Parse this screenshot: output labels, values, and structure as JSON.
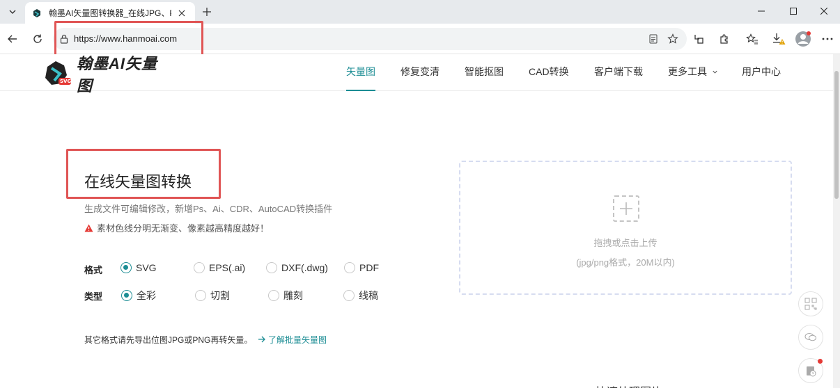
{
  "browser": {
    "tab_title": "翰墨AI矢量图转换器_在线JPG、PNG",
    "url": "https://www.hanmoai.com"
  },
  "site": {
    "logo_text": "翰墨AI矢量图",
    "logo_badge": "SVG",
    "nav": [
      {
        "label": "矢量图"
      },
      {
        "label": "修复变清"
      },
      {
        "label": "智能抠图"
      },
      {
        "label": "CAD转换"
      },
      {
        "label": "客户端下载"
      },
      {
        "label": "更多工具"
      },
      {
        "label": "用户中心"
      }
    ]
  },
  "hero": {
    "title": "在线矢量图转换",
    "subtitle": "生成文件可编辑修改，新增Ps、Ai、CDR、AutoCAD转换插件",
    "warning": "素材色线分明无渐变、像素越高精度越好！"
  },
  "format": {
    "label": "格式",
    "options": [
      "SVG",
      "EPS(.ai)",
      "DXF(.dwg)",
      "PDF"
    ],
    "selected": "SVG"
  },
  "type": {
    "label": "类型",
    "options": [
      "全彩",
      "切割",
      "雕刻",
      "线稿"
    ],
    "selected": "全彩"
  },
  "note": {
    "text": "其它格式请先导出位图JPG或PNG再转矢量。",
    "link": "了解批量矢量图"
  },
  "upload": {
    "text": "拖拽或点击上传",
    "hint": "(jpg/png格式，20M以内)"
  },
  "colors": {
    "accent": "#1c8d94",
    "highlight": "#e05555",
    "warning": "#e53935"
  },
  "bottom_peek": "快速处理图片"
}
